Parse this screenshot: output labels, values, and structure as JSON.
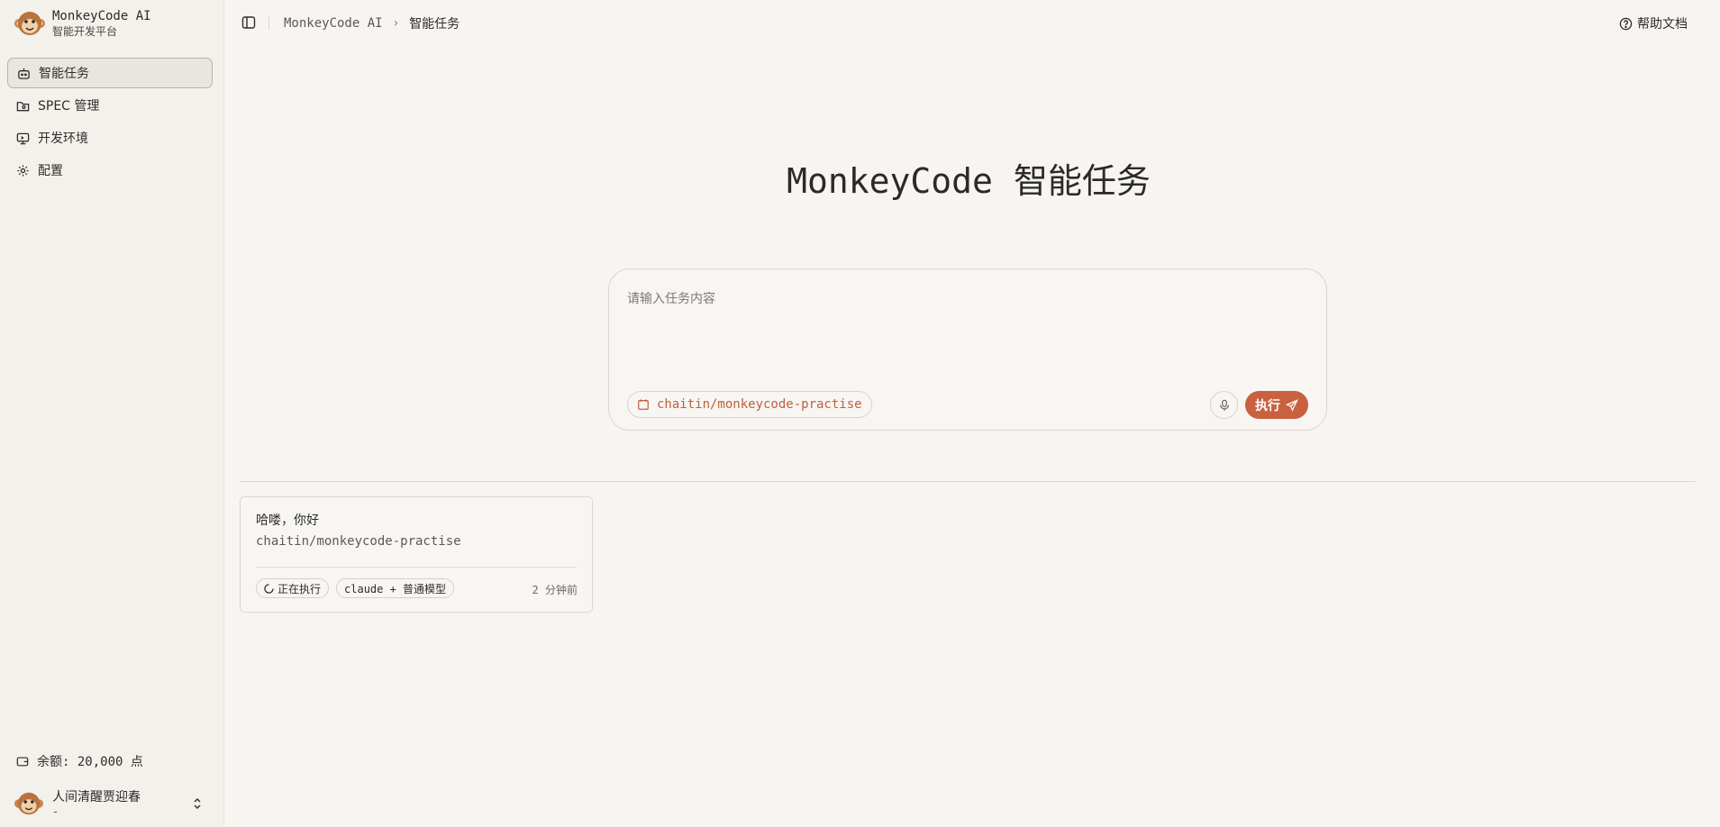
{
  "brand": {
    "name": "MonkeyCode AI",
    "subtitle": "智能开发平台"
  },
  "sidebar": {
    "items": [
      {
        "label": "智能任务",
        "icon": "bot-icon",
        "active": true
      },
      {
        "label": "SPEC 管理",
        "icon": "folder-icon",
        "active": false
      },
      {
        "label": "开发环境",
        "icon": "monitor-icon",
        "active": false
      },
      {
        "label": "配置",
        "icon": "gear-icon",
        "active": false
      }
    ],
    "balance": "余额: 20,000 点",
    "user": {
      "name": "人间清醒贾迎春",
      "sub": "-"
    }
  },
  "header": {
    "breadcrumb": [
      "MonkeyCode AI",
      "智能任务"
    ],
    "help_label": "帮助文档"
  },
  "main": {
    "title": "MonkeyCode 智能任务",
    "composer": {
      "placeholder": "请输入任务内容",
      "repo": "chaitin/monkeycode-practise",
      "exec_label": "执行"
    },
    "tasks": [
      {
        "title": "哈喽，你好",
        "repo": "chaitin/monkeycode-practise",
        "status": "正在执行",
        "model": "claude + 普通模型",
        "time": "2 分钟前"
      }
    ]
  },
  "colors": {
    "accent": "#c9603f",
    "background": "#f7f5f1",
    "sidebar": "#f3f1ec"
  }
}
